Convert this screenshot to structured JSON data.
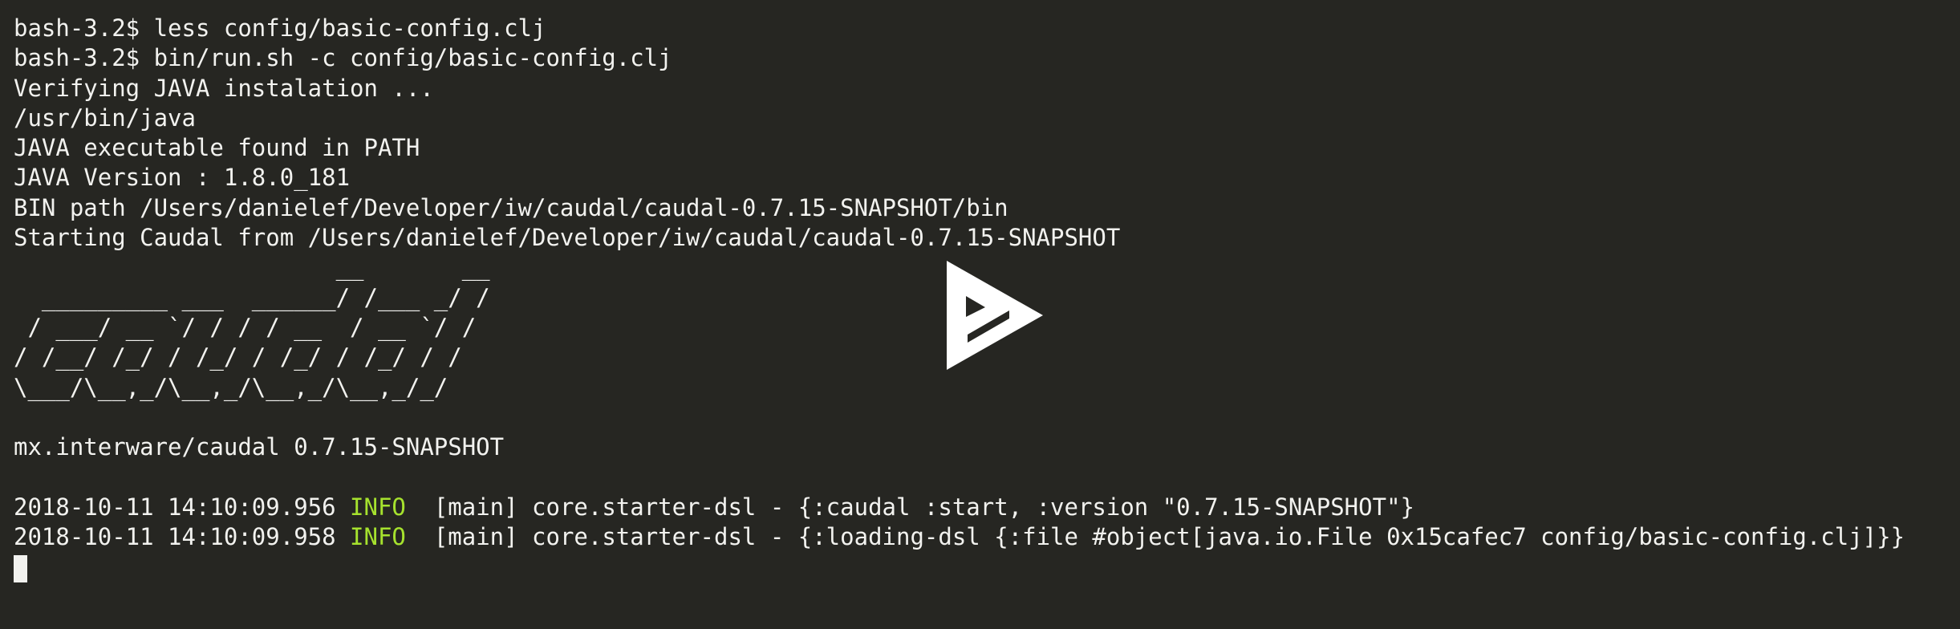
{
  "terminal": {
    "lines": [
      "bash-3.2$ less config/basic-config.clj",
      "bash-3.2$ bin/run.sh -c config/basic-config.clj",
      "Verifying JAVA instalation ...",
      "/usr/bin/java",
      "JAVA executable found in PATH",
      "JAVA Version : 1.8.0_181",
      "BIN path /Users/danielef/Developer/iw/caudal/caudal-0.7.15-SNAPSHOT/bin",
      "Starting Caudal from /Users/danielef/Developer/iw/caudal/caudal-0.7.15-SNAPSHOT"
    ],
    "ascii_art": [
      "                       __       __",
      "  _________ ___  ______/ /___ _/ /",
      " / ___/ __ `/ / / / __  / __ `/ /",
      "/ /__/ /_/ / /_/ / /_/ / /_/ / /",
      "\\___/\\__,_/\\__,_/\\__,_/\\__,_/_/"
    ],
    "version_line": "mx.interware/caudal 0.7.15-SNAPSHOT",
    "log_lines": [
      {
        "timestamp": "2018-10-11 14:10:09.956",
        "level": "INFO",
        "message": " [main] core.starter-dsl - {:caudal :start, :version \"0.7.15-SNAPSHOT\"}"
      },
      {
        "timestamp": "2018-10-11 14:10:09.958",
        "level": "INFO",
        "message": " [main] core.starter-dsl - {:loading-dsl {:file #object[java.io.File 0x15cafec7 config/basic-config.clj]}}"
      }
    ]
  },
  "colors": {
    "background": "#262622",
    "foreground": "#f2f2ef",
    "info": "#a6e22e",
    "play_icon": "#ffffff"
  },
  "player": {
    "icon": "asciinema-play-icon"
  }
}
